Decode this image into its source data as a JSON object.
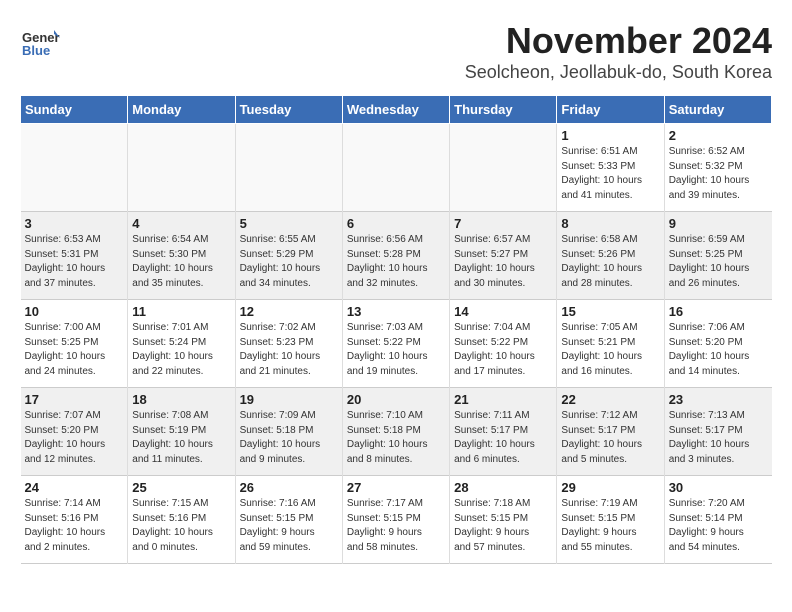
{
  "header": {
    "logo_line1": "General",
    "logo_line2": "Blue",
    "month_year": "November 2024",
    "location": "Seolcheon, Jeollabuk-do, South Korea"
  },
  "days_of_week": [
    "Sunday",
    "Monday",
    "Tuesday",
    "Wednesday",
    "Thursday",
    "Friday",
    "Saturday"
  ],
  "weeks": [
    [
      {
        "num": "",
        "info": ""
      },
      {
        "num": "",
        "info": ""
      },
      {
        "num": "",
        "info": ""
      },
      {
        "num": "",
        "info": ""
      },
      {
        "num": "",
        "info": ""
      },
      {
        "num": "1",
        "info": "Sunrise: 6:51 AM\nSunset: 5:33 PM\nDaylight: 10 hours\nand 41 minutes."
      },
      {
        "num": "2",
        "info": "Sunrise: 6:52 AM\nSunset: 5:32 PM\nDaylight: 10 hours\nand 39 minutes."
      }
    ],
    [
      {
        "num": "3",
        "info": "Sunrise: 6:53 AM\nSunset: 5:31 PM\nDaylight: 10 hours\nand 37 minutes."
      },
      {
        "num": "4",
        "info": "Sunrise: 6:54 AM\nSunset: 5:30 PM\nDaylight: 10 hours\nand 35 minutes."
      },
      {
        "num": "5",
        "info": "Sunrise: 6:55 AM\nSunset: 5:29 PM\nDaylight: 10 hours\nand 34 minutes."
      },
      {
        "num": "6",
        "info": "Sunrise: 6:56 AM\nSunset: 5:28 PM\nDaylight: 10 hours\nand 32 minutes."
      },
      {
        "num": "7",
        "info": "Sunrise: 6:57 AM\nSunset: 5:27 PM\nDaylight: 10 hours\nand 30 minutes."
      },
      {
        "num": "8",
        "info": "Sunrise: 6:58 AM\nSunset: 5:26 PM\nDaylight: 10 hours\nand 28 minutes."
      },
      {
        "num": "9",
        "info": "Sunrise: 6:59 AM\nSunset: 5:25 PM\nDaylight: 10 hours\nand 26 minutes."
      }
    ],
    [
      {
        "num": "10",
        "info": "Sunrise: 7:00 AM\nSunset: 5:25 PM\nDaylight: 10 hours\nand 24 minutes."
      },
      {
        "num": "11",
        "info": "Sunrise: 7:01 AM\nSunset: 5:24 PM\nDaylight: 10 hours\nand 22 minutes."
      },
      {
        "num": "12",
        "info": "Sunrise: 7:02 AM\nSunset: 5:23 PM\nDaylight: 10 hours\nand 21 minutes."
      },
      {
        "num": "13",
        "info": "Sunrise: 7:03 AM\nSunset: 5:22 PM\nDaylight: 10 hours\nand 19 minutes."
      },
      {
        "num": "14",
        "info": "Sunrise: 7:04 AM\nSunset: 5:22 PM\nDaylight: 10 hours\nand 17 minutes."
      },
      {
        "num": "15",
        "info": "Sunrise: 7:05 AM\nSunset: 5:21 PM\nDaylight: 10 hours\nand 16 minutes."
      },
      {
        "num": "16",
        "info": "Sunrise: 7:06 AM\nSunset: 5:20 PM\nDaylight: 10 hours\nand 14 minutes."
      }
    ],
    [
      {
        "num": "17",
        "info": "Sunrise: 7:07 AM\nSunset: 5:20 PM\nDaylight: 10 hours\nand 12 minutes."
      },
      {
        "num": "18",
        "info": "Sunrise: 7:08 AM\nSunset: 5:19 PM\nDaylight: 10 hours\nand 11 minutes."
      },
      {
        "num": "19",
        "info": "Sunrise: 7:09 AM\nSunset: 5:18 PM\nDaylight: 10 hours\nand 9 minutes."
      },
      {
        "num": "20",
        "info": "Sunrise: 7:10 AM\nSunset: 5:18 PM\nDaylight: 10 hours\nand 8 minutes."
      },
      {
        "num": "21",
        "info": "Sunrise: 7:11 AM\nSunset: 5:17 PM\nDaylight: 10 hours\nand 6 minutes."
      },
      {
        "num": "22",
        "info": "Sunrise: 7:12 AM\nSunset: 5:17 PM\nDaylight: 10 hours\nand 5 minutes."
      },
      {
        "num": "23",
        "info": "Sunrise: 7:13 AM\nSunset: 5:17 PM\nDaylight: 10 hours\nand 3 minutes."
      }
    ],
    [
      {
        "num": "24",
        "info": "Sunrise: 7:14 AM\nSunset: 5:16 PM\nDaylight: 10 hours\nand 2 minutes."
      },
      {
        "num": "25",
        "info": "Sunrise: 7:15 AM\nSunset: 5:16 PM\nDaylight: 10 hours\nand 0 minutes."
      },
      {
        "num": "26",
        "info": "Sunrise: 7:16 AM\nSunset: 5:15 PM\nDaylight: 9 hours\nand 59 minutes."
      },
      {
        "num": "27",
        "info": "Sunrise: 7:17 AM\nSunset: 5:15 PM\nDaylight: 9 hours\nand 58 minutes."
      },
      {
        "num": "28",
        "info": "Sunrise: 7:18 AM\nSunset: 5:15 PM\nDaylight: 9 hours\nand 57 minutes."
      },
      {
        "num": "29",
        "info": "Sunrise: 7:19 AM\nSunset: 5:15 PM\nDaylight: 9 hours\nand 55 minutes."
      },
      {
        "num": "30",
        "info": "Sunrise: 7:20 AM\nSunset: 5:14 PM\nDaylight: 9 hours\nand 54 minutes."
      }
    ]
  ]
}
